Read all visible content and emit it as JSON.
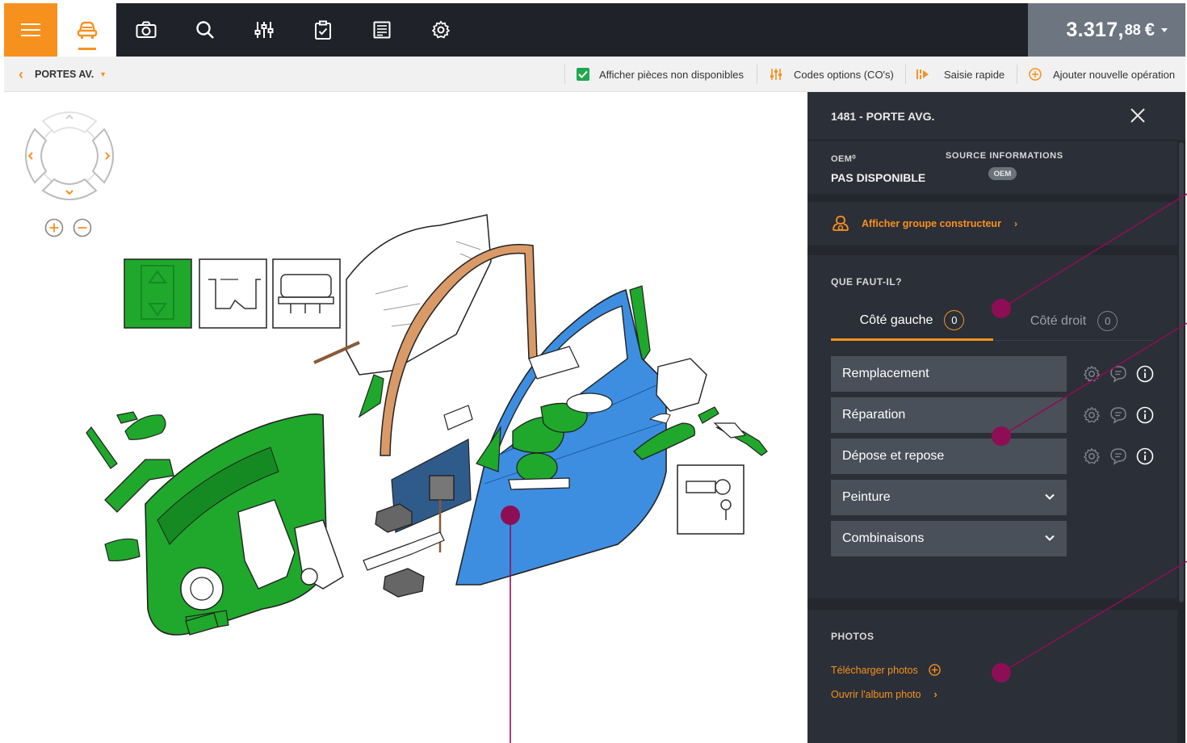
{
  "price": {
    "main": "3.317,",
    "cents": "88",
    "currency": "€"
  },
  "subbar": {
    "breadcrumb": "PORTES AV.",
    "show_unavailable": "Afficher pièces non disponibles",
    "option_codes": "Codes options (CO's)",
    "quick_entry": "Saisie rapide",
    "add_operation": "Ajouter nouvelle opération"
  },
  "panel": {
    "title": "1481 - PORTE AVG.",
    "oem_label": "OEM⁰",
    "oem_value": "PAS DISPONIBLE",
    "source_label": "SOURCE INFORMATIONS",
    "source_badge": "OEM",
    "group_link": "Afficher groupe constructeur",
    "que_label": "QUE FAUT-IL?",
    "tabs": [
      {
        "label": "Côté gauche",
        "count": "0"
      },
      {
        "label": "Côté droit",
        "count": "0"
      }
    ],
    "operations": [
      {
        "label": "Remplacement"
      },
      {
        "label": "Réparation"
      },
      {
        "label": "Dépose et repose"
      },
      {
        "label": "Peinture"
      },
      {
        "label": "Combinaisons"
      }
    ],
    "photos_label": "PHOTOS",
    "upload_photos": "Télécharger photos",
    "open_album": "Ouvrir l'album photo"
  },
  "colors": {
    "accent": "#f7911e",
    "topbar": "#1f2229",
    "panel": "#2b2f37",
    "part_green": "#1fa82b",
    "part_blue": "#3d8ee0",
    "part_tan": "#d99a68",
    "annotation": "#8e0e56"
  }
}
